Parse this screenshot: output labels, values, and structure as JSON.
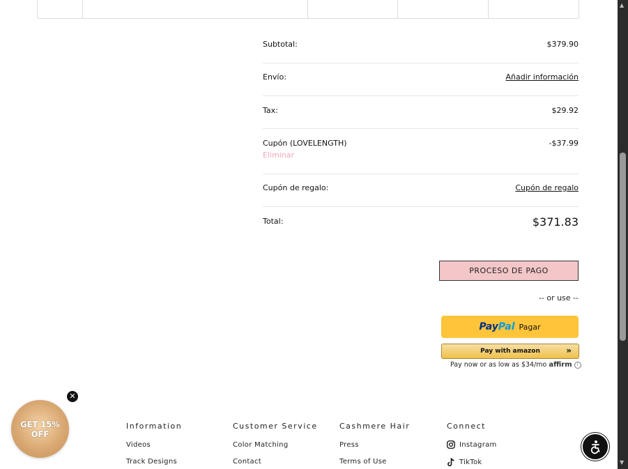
{
  "summary": {
    "subtotal_label": "Subtotal:",
    "subtotal_value": "$379.90",
    "shipping_label": "Envío:",
    "shipping_link": "Añadir información",
    "tax_label": "Tax:",
    "tax_value": "$29.92",
    "coupon_label": "Cupón (LOVELENGTH)",
    "coupon_value": "-$37.99",
    "coupon_remove": "Eliminar",
    "gift_label": "Cupón de regalo:",
    "gift_link": "Cupón de regalo",
    "total_label": "Total:",
    "total_value": "$371.83"
  },
  "checkout": {
    "checkout_button": "PROCESO DE PAGO",
    "or_use": "-- or use --",
    "paypal_pay": "Pay",
    "paypal_pal": "Pal",
    "paypal_action": "Pagar",
    "amazon_label": "Pay with amazon",
    "affirm_text": "Pay now or as low as $34/mo",
    "affirm_brand": "affirm"
  },
  "footer": {
    "col1_title": "Information",
    "col1_links": [
      "Videos",
      "Track Designs"
    ],
    "col2_title": "Customer Service",
    "col2_links": [
      "Color Matching",
      "Contact"
    ],
    "col3_title": "Cashmere Hair",
    "col3_links": [
      "Press",
      "Terms of Use"
    ],
    "col4_title": "Connect",
    "col4_links": [
      "Instagram",
      "TikTok"
    ]
  },
  "promo": {
    "line1": "GET 15%",
    "line2": "OFF"
  },
  "colors": {
    "checkout_bg": "#f3c6c8",
    "paypal_bg": "#ffc439",
    "remove_link": "#f0a8b8"
  },
  "icons": [
    "close-icon",
    "instagram-icon",
    "tiktok-icon",
    "accessibility-icon",
    "chevron-right-icon",
    "info-icon"
  ]
}
